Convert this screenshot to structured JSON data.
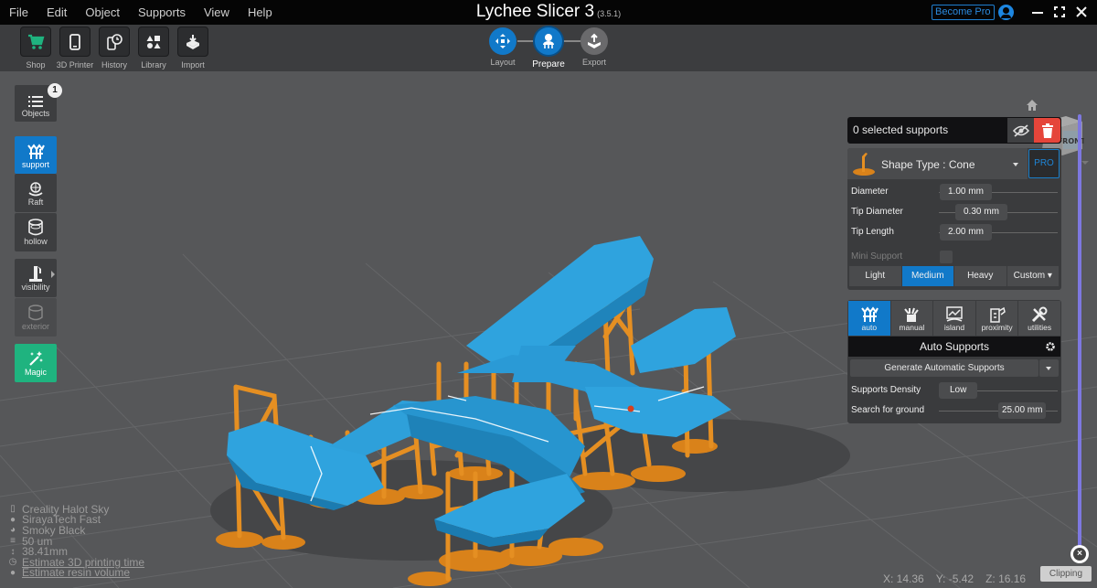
{
  "menu": [
    "File",
    "Edit",
    "Object",
    "Supports",
    "View",
    "Help"
  ],
  "app": {
    "title": "Lychee Slicer 3",
    "version": "(3.5.1)",
    "become_pro": "Become Pro"
  },
  "toolbar": [
    {
      "label": "Shop",
      "icon": "cart-icon"
    },
    {
      "label": "3D Printer",
      "icon": "phone-printer-icon"
    },
    {
      "label": "History",
      "icon": "history-icon"
    },
    {
      "label": "Library",
      "icon": "library-shapes-icon"
    },
    {
      "label": "Import",
      "icon": "import-icon"
    }
  ],
  "workflow": [
    {
      "label": "Layout",
      "state": "done"
    },
    {
      "label": "Prepare",
      "state": "active"
    },
    {
      "label": "Export",
      "state": "inactive"
    }
  ],
  "sidebar": {
    "objects": {
      "label": "Objects",
      "count": "1"
    },
    "items": [
      {
        "label": "support",
        "active": true
      },
      {
        "label": "Raft"
      },
      {
        "label": "hollow"
      },
      {
        "label": "visibility"
      },
      {
        "label": "exterior",
        "disabled": true
      },
      {
        "label": "Magic"
      }
    ]
  },
  "navcube": {
    "face": "FRONT"
  },
  "supports_panel": {
    "selected": "0 selected supports",
    "shape_type": "Shape Type : Cone",
    "pro": "PRO",
    "params": [
      {
        "label": "Diameter",
        "value": "1.00 mm"
      },
      {
        "label": "Tip Diameter",
        "value": "0.30 mm"
      },
      {
        "label": "Tip Length",
        "value": "2.00 mm"
      }
    ],
    "mini_support": {
      "label": "Mini Support",
      "checked": false
    },
    "presets": [
      "Light",
      "Medium",
      "Heavy",
      "Custom"
    ],
    "active_preset": "Medium"
  },
  "mode_panel": {
    "tabs": [
      "auto",
      "manual",
      "island",
      "proximity",
      "utilities"
    ],
    "active_tab": "auto",
    "header": "Auto Supports",
    "generate": "Generate Automatic Supports",
    "density": {
      "label": "Supports Density",
      "value": "Low"
    },
    "search_ground": {
      "label": "Search for ground",
      "value": "25.00 mm"
    }
  },
  "info": {
    "printer": "Creality Halot Sky",
    "resin": "SirayaTech Fast",
    "color": "Smoky Black",
    "layer": "50 um",
    "height": "38.41mm",
    "estimate_time": "Estimate 3D printing time",
    "estimate_volume": "Estimate resin volume"
  },
  "coords": {
    "x": "X: 14.36",
    "y": "Y: -5.42",
    "z": "Z: 16.16"
  },
  "clipping": {
    "label": "Clipping"
  },
  "colors": {
    "accent": "#1179c9",
    "model": "#2a9ad6",
    "support": "#e08a1e",
    "danger": "#e5453a",
    "magic": "#1fb37f",
    "clip": "#7d78e0"
  }
}
